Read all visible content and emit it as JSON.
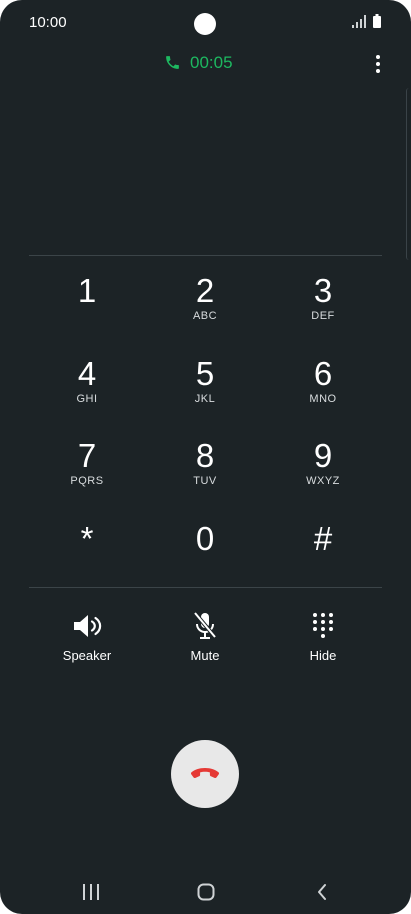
{
  "status_bar": {
    "time": "10:00"
  },
  "call": {
    "timer": "00:05",
    "accent_color": "#1db860"
  },
  "keypad": {
    "keys": [
      {
        "digit": "1",
        "letters": ""
      },
      {
        "digit": "2",
        "letters": "ABC"
      },
      {
        "digit": "3",
        "letters": "DEF"
      },
      {
        "digit": "4",
        "letters": "GHI"
      },
      {
        "digit": "5",
        "letters": "JKL"
      },
      {
        "digit": "6",
        "letters": "MNO"
      },
      {
        "digit": "7",
        "letters": "PQRS"
      },
      {
        "digit": "8",
        "letters": "TUV"
      },
      {
        "digit": "9",
        "letters": "WXYZ"
      },
      {
        "digit": "*",
        "letters": ""
      },
      {
        "digit": "0",
        "letters": ""
      },
      {
        "digit": "#",
        "letters": ""
      }
    ]
  },
  "actions": {
    "speaker_label": "Speaker",
    "mute_label": "Mute",
    "hide_label": "Hide"
  },
  "end_call": {
    "icon": "end-call-icon",
    "color": "#e53935"
  },
  "nav_bar": {
    "icons": [
      "recent-apps-icon",
      "home-icon",
      "back-icon"
    ]
  }
}
